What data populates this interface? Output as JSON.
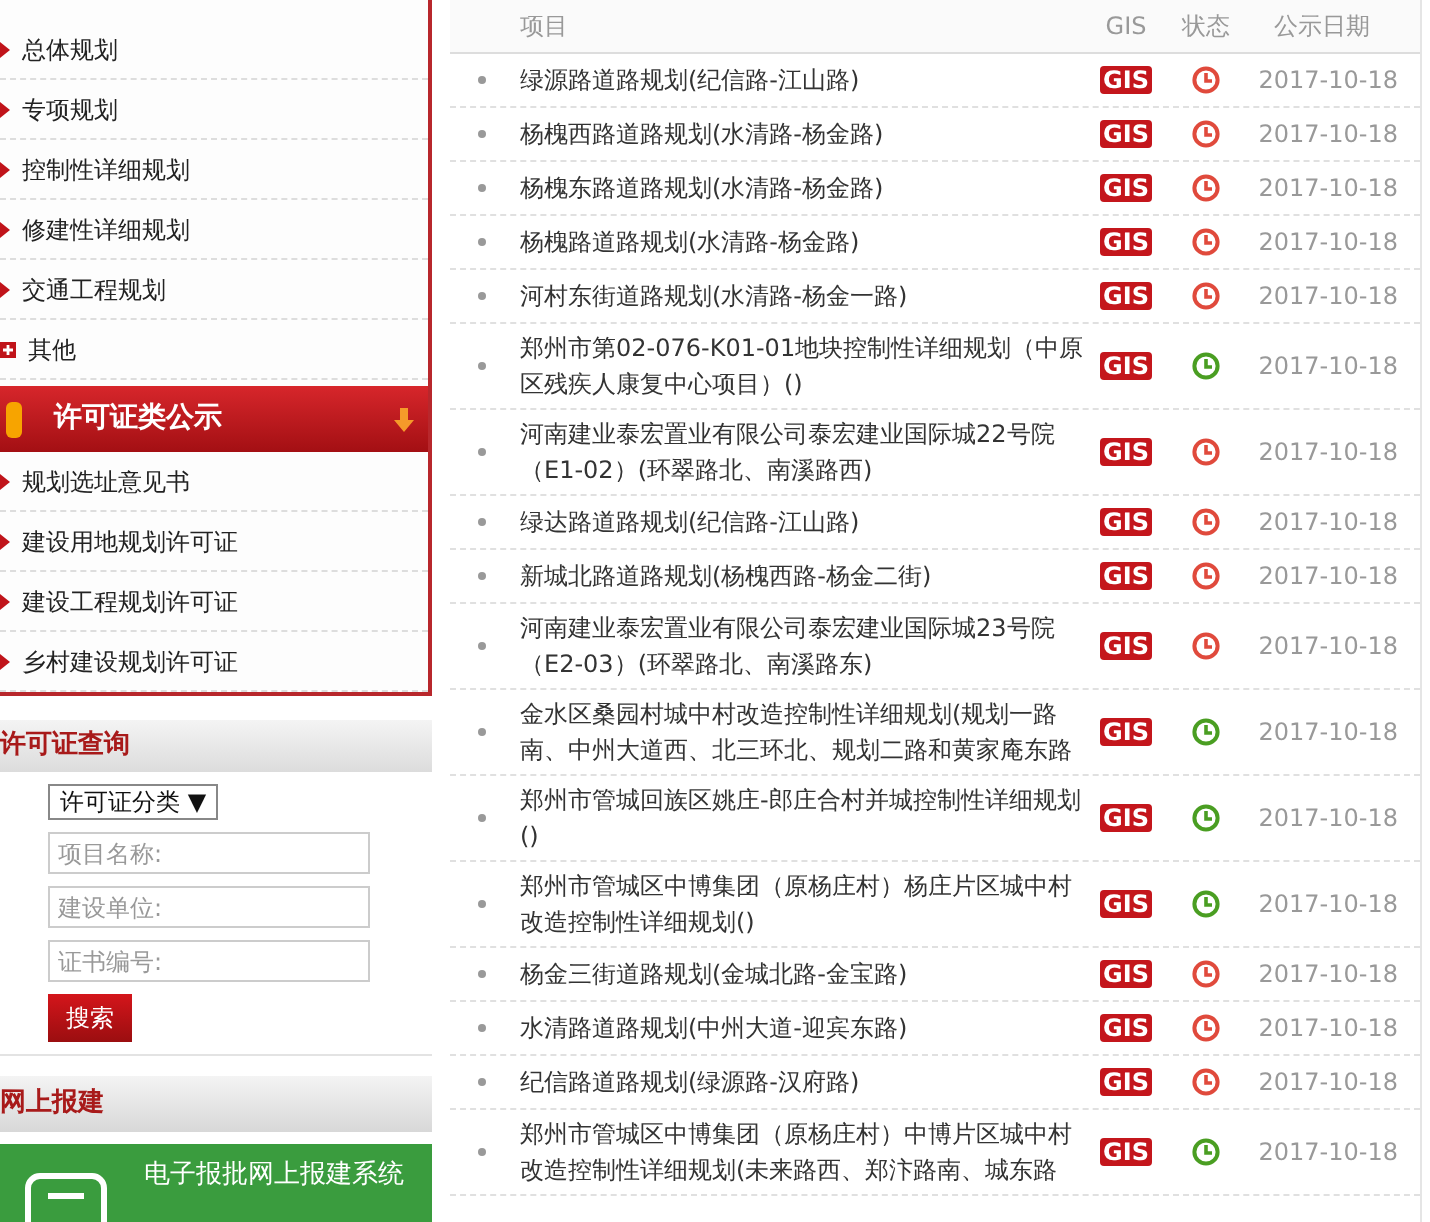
{
  "plan_nav": {
    "items": [
      {
        "label": "总体规划",
        "kind": "arrow"
      },
      {
        "label": "专项规划",
        "kind": "arrow"
      },
      {
        "label": "控制性详细规划",
        "kind": "arrow"
      },
      {
        "label": "修建性详细规划",
        "kind": "arrow"
      },
      {
        "label": "交通工程规划",
        "kind": "arrow"
      },
      {
        "label": "其他",
        "kind": "plus"
      }
    ]
  },
  "permit_nav": {
    "title": "许可证类公示",
    "items": [
      {
        "label": "规划选址意见书"
      },
      {
        "label": "建设用地规划许可证"
      },
      {
        "label": "建设工程规划许可证"
      },
      {
        "label": "乡村建设规划许可证"
      }
    ]
  },
  "permit_search": {
    "title": "许可证查询",
    "category": "许可证分类 ▼",
    "fields": [
      {
        "placeholder": "项目名称:"
      },
      {
        "placeholder": "建设单位:"
      },
      {
        "placeholder": "证书编号:"
      }
    ],
    "button": "搜索"
  },
  "online_apply": {
    "title": "网上报建",
    "banner": "电子报批网上报建系统"
  },
  "table": {
    "columns": [
      "项目",
      "GIS",
      "状态",
      "公示日期"
    ],
    "rows": [
      {
        "project": "绿源路道路规划(纪信路-江山路)",
        "gis": "GIS",
        "color": "#e04a3c",
        "date": "2017-10-18"
      },
      {
        "project": "杨槐西路道路规划(水清路-杨金路)",
        "gis": "GIS",
        "color": "#e04a3c",
        "date": "2017-10-18"
      },
      {
        "project": "杨槐东路道路规划(水清路-杨金路)",
        "gis": "GIS",
        "color": "#e04a3c",
        "date": "2017-10-18"
      },
      {
        "project": "杨槐路道路规划(水清路-杨金路)",
        "gis": "GIS",
        "color": "#e04a3c",
        "date": "2017-10-18"
      },
      {
        "project": "河村东街道路规划(水清路-杨金一路)",
        "gis": "GIS",
        "color": "#e04a3c",
        "date": "2017-10-18"
      },
      {
        "project": "郑州市第02-076-K01-01地块控制性详细规划（中原区残疾人康复中心项目）()",
        "gis": "GIS",
        "color": "#4a9e22",
        "date": "2017-10-18"
      },
      {
        "project": "河南建业泰宏置业有限公司泰宏建业国际城22号院（E1-02）(环翠路北、南溪路西)",
        "gis": "GIS",
        "color": "#e04a3c",
        "date": "2017-10-18"
      },
      {
        "project": "绿达路道路规划(纪信路-江山路)",
        "gis": "GIS",
        "color": "#e04a3c",
        "date": "2017-10-18"
      },
      {
        "project": "新城北路道路规划(杨槐西路-杨金二街)",
        "gis": "GIS",
        "color": "#e04a3c",
        "date": "2017-10-18"
      },
      {
        "project": "河南建业泰宏置业有限公司泰宏建业国际城23号院（E2-03）(环翠路北、南溪路东)",
        "gis": "GIS",
        "color": "#e04a3c",
        "date": "2017-10-18"
      },
      {
        "project": "金水区桑园村城中村改造控制性详细规划(规划一路南、中州大道西、北三环北、规划二路和黄家庵东路",
        "gis": "GIS",
        "color": "#4a9e22",
        "date": "2017-10-18"
      },
      {
        "project": "郑州市管城回族区姚庄-郎庄合村并城控制性详细规划()",
        "gis": "GIS",
        "color": "#4a9e22",
        "date": "2017-10-18"
      },
      {
        "project": "郑州市管城区中博集团（原杨庄村）杨庄片区城中村改造控制性详细规划()",
        "gis": "GIS",
        "color": "#4a9e22",
        "date": "2017-10-18"
      },
      {
        "project": "杨金三街道路规划(金城北路-金宝路)",
        "gis": "GIS",
        "color": "#e04a3c",
        "date": "2017-10-18"
      },
      {
        "project": "水清路道路规划(中州大道-迎宾东路)",
        "gis": "GIS",
        "color": "#e04a3c",
        "date": "2017-10-18"
      },
      {
        "project": "纪信路道路规划(绿源路-汉府路)",
        "gis": "GIS",
        "color": "#e04a3c",
        "date": "2017-10-18"
      },
      {
        "project": "郑州市管城区中博集团（原杨庄村）中博片区城中村改造控制性详细规划(未来路西、郑汴路南、城东路",
        "gis": "GIS",
        "color": "#4a9e22",
        "date": "2017-10-18"
      }
    ]
  }
}
